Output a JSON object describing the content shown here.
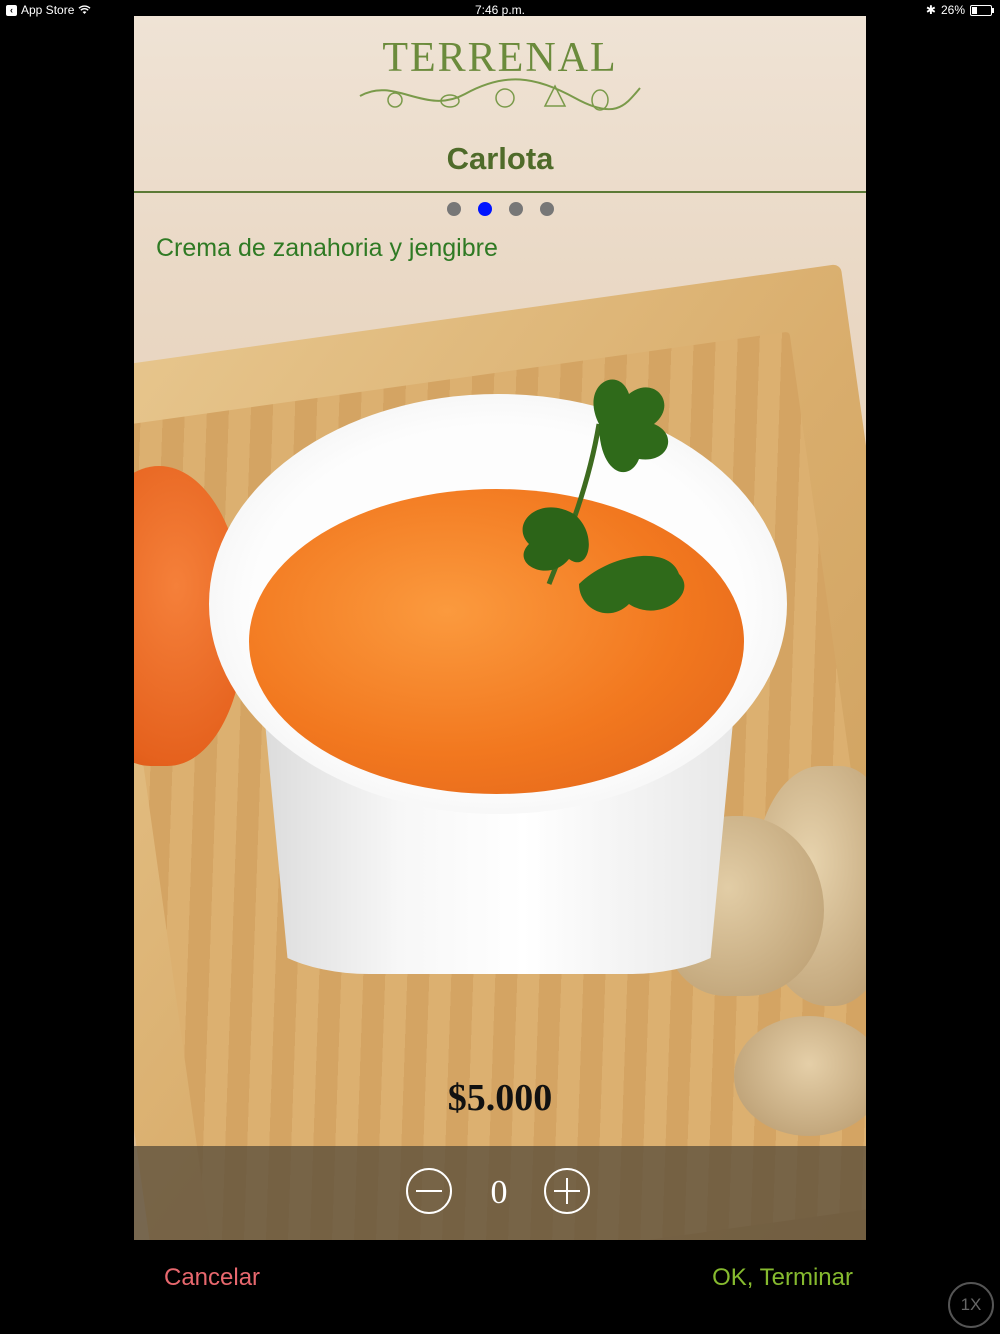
{
  "status_bar": {
    "back_app": "App Store",
    "time": "7:46 p.m.",
    "battery_percent": "26%",
    "battery_level": 0.26
  },
  "header": {
    "logo_text": "TERRENAL",
    "product_name": "Carlota"
  },
  "pager": {
    "count": 4,
    "active_index": 1
  },
  "product": {
    "description": "Crema de zanahoria y jengibre",
    "price": "$5.000",
    "quantity": "0"
  },
  "actions": {
    "cancel_label": "Cancelar",
    "ok_label": "OK, Terminar",
    "scale_label": "1X"
  },
  "colors": {
    "active_dot": "#0014ff",
    "cancel": "#e8686e",
    "ok": "#86ba2f",
    "title_green": "#4f6b2a"
  }
}
